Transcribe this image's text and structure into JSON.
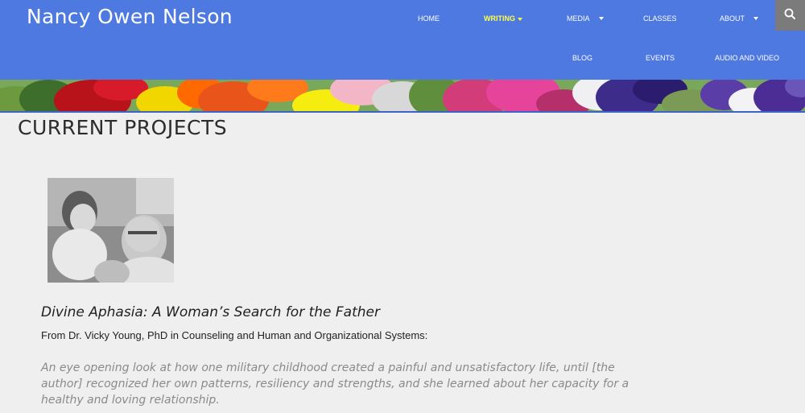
{
  "site": {
    "title": "Nancy Owen Nelson"
  },
  "nav": {
    "home": "HOME",
    "writing": "WRITING",
    "media": "MEDIA",
    "classes": "CLASSES",
    "about": "ABOUT",
    "blog": "BLOG",
    "events": "EVENTS",
    "audio_video": "AUDIO AND VIDEO",
    "active_color": "#ffff4a"
  },
  "icons": {
    "search": "search-icon",
    "dropdown": "chevron-down-icon"
  },
  "colors": {
    "header_bg": "#4d79e0",
    "page_bg": "#efefef",
    "search_bg": "#7b7b7b"
  },
  "page": {
    "title": "CURRENT PROJECTS"
  },
  "project": {
    "title": "Divine Aphasia: A Woman’s Search for the Father",
    "from": "From Dr. Vicky Young, PhD in Counseling and Human and Organizational Systems:",
    "quote": "An eye opening look at how one military childhood created a painful and unsatisfactory life, until [the author] recognized her own patterns, resiliency and strengths, and she learned about her capacity for a healthy and loving relationship."
  }
}
